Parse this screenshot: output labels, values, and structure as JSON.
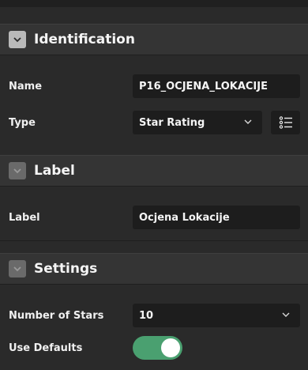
{
  "sections": {
    "identification": {
      "title": "Identification",
      "name_label": "Name",
      "name_value": "P16_OCJENA_LOKACIJE",
      "type_label": "Type",
      "type_value": "Star Rating"
    },
    "label": {
      "title": "Label",
      "label_label": "Label",
      "label_value": "Ocjena Lokacije"
    },
    "settings": {
      "title": "Settings",
      "stars_label": "Number of Stars",
      "stars_value": "10",
      "defaults_label": "Use Defaults",
      "defaults_on": true
    }
  },
  "colors": {
    "background": "#2a2a2a",
    "header": "#343434",
    "field": "#1d1d1d",
    "toggle_on": "#4aa070"
  },
  "icons": {
    "collapse": "chevron-down-icon",
    "select": "chevron-down-icon",
    "list_of_values": "list-icon"
  }
}
